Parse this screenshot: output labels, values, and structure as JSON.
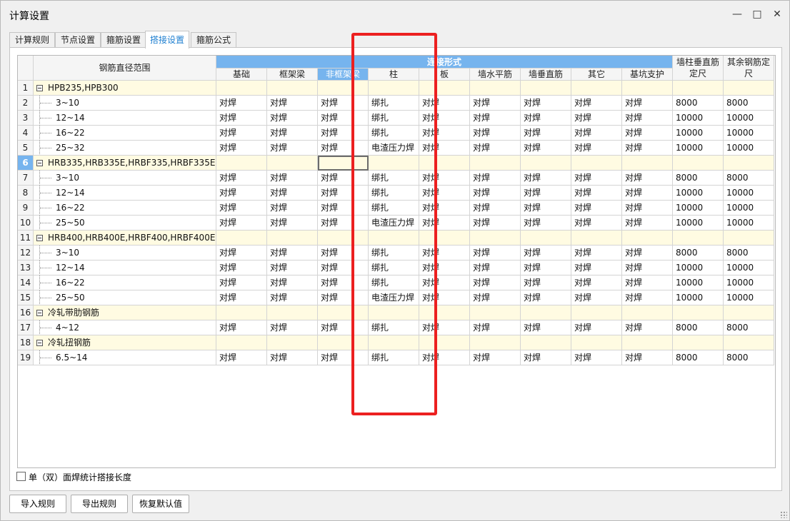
{
  "window": {
    "title": "计算设置"
  },
  "tabs": [
    {
      "label": "计算规则",
      "active": false
    },
    {
      "label": "节点设置",
      "active": false
    },
    {
      "label": "箍筋设置",
      "active": false
    },
    {
      "label": "搭接设置",
      "active": true
    },
    {
      "label": "箍筋公式",
      "active": false
    }
  ],
  "table": {
    "range_header": "钢筋直径范围",
    "group_header": "连接形式",
    "columns": [
      "基础",
      "框架梁",
      "非框架梁",
      "柱",
      "板",
      "墙水平筋",
      "墙垂直筋",
      "其它",
      "基坑支护"
    ],
    "extra_headers": [
      "墙柱垂直筋定尺",
      "其余钢筋定尺"
    ],
    "selected_column": 2,
    "selected_row": 6,
    "rows": [
      {
        "n": "1",
        "label": "HPB235,HPB300",
        "group": true
      },
      {
        "n": "2",
        "label": "3~10",
        "cells": [
          "对焊",
          "对焊",
          "对焊",
          "绑扎",
          "对焊",
          "对焊",
          "对焊",
          "对焊",
          "对焊",
          "8000",
          "8000"
        ]
      },
      {
        "n": "3",
        "label": "12~14",
        "cells": [
          "对焊",
          "对焊",
          "对焊",
          "绑扎",
          "对焊",
          "对焊",
          "对焊",
          "对焊",
          "对焊",
          "10000",
          "10000"
        ]
      },
      {
        "n": "4",
        "label": "16~22",
        "cells": [
          "对焊",
          "对焊",
          "对焊",
          "绑扎",
          "对焊",
          "对焊",
          "对焊",
          "对焊",
          "对焊",
          "10000",
          "10000"
        ]
      },
      {
        "n": "5",
        "label": "25~32",
        "cells": [
          "对焊",
          "对焊",
          "对焊",
          "电渣压力焊",
          "对焊",
          "对焊",
          "对焊",
          "对焊",
          "对焊",
          "10000",
          "10000"
        ]
      },
      {
        "n": "6",
        "label": "HRB335,HRB335E,HRBF335,HRBF335E",
        "group": true
      },
      {
        "n": "7",
        "label": "3~10",
        "cells": [
          "对焊",
          "对焊",
          "对焊",
          "绑扎",
          "对焊",
          "对焊",
          "对焊",
          "对焊",
          "对焊",
          "8000",
          "8000"
        ]
      },
      {
        "n": "8",
        "label": "12~14",
        "cells": [
          "对焊",
          "对焊",
          "对焊",
          "绑扎",
          "对焊",
          "对焊",
          "对焊",
          "对焊",
          "对焊",
          "10000",
          "10000"
        ]
      },
      {
        "n": "9",
        "label": "16~22",
        "cells": [
          "对焊",
          "对焊",
          "对焊",
          "绑扎",
          "对焊",
          "对焊",
          "对焊",
          "对焊",
          "对焊",
          "10000",
          "10000"
        ]
      },
      {
        "n": "10",
        "label": "25~50",
        "cells": [
          "对焊",
          "对焊",
          "对焊",
          "电渣压力焊",
          "对焊",
          "对焊",
          "对焊",
          "对焊",
          "对焊",
          "10000",
          "10000"
        ]
      },
      {
        "n": "11",
        "label": "HRB400,HRB400E,HRBF400,HRBF400E...",
        "group": true
      },
      {
        "n": "12",
        "label": "3~10",
        "cells": [
          "对焊",
          "对焊",
          "对焊",
          "绑扎",
          "对焊",
          "对焊",
          "对焊",
          "对焊",
          "对焊",
          "8000",
          "8000"
        ]
      },
      {
        "n": "13",
        "label": "12~14",
        "cells": [
          "对焊",
          "对焊",
          "对焊",
          "绑扎",
          "对焊",
          "对焊",
          "对焊",
          "对焊",
          "对焊",
          "10000",
          "10000"
        ]
      },
      {
        "n": "14",
        "label": "16~22",
        "cells": [
          "对焊",
          "对焊",
          "对焊",
          "绑扎",
          "对焊",
          "对焊",
          "对焊",
          "对焊",
          "对焊",
          "10000",
          "10000"
        ]
      },
      {
        "n": "15",
        "label": "25~50",
        "cells": [
          "对焊",
          "对焊",
          "对焊",
          "电渣压力焊",
          "对焊",
          "对焊",
          "对焊",
          "对焊",
          "对焊",
          "10000",
          "10000"
        ]
      },
      {
        "n": "16",
        "label": "冷轧带肋钢筋",
        "group": true
      },
      {
        "n": "17",
        "label": "4~12",
        "cells": [
          "对焊",
          "对焊",
          "对焊",
          "绑扎",
          "对焊",
          "对焊",
          "对焊",
          "对焊",
          "对焊",
          "8000",
          "8000"
        ]
      },
      {
        "n": "18",
        "label": "冷轧扭钢筋",
        "group": true
      },
      {
        "n": "19",
        "label": "6.5~14",
        "cells": [
          "对焊",
          "对焊",
          "对焊",
          "绑扎",
          "对焊",
          "对焊",
          "对焊",
          "对焊",
          "对焊",
          "8000",
          "8000"
        ]
      }
    ]
  },
  "checkbox": {
    "label": "单（双）面焊统计搭接长度",
    "checked": false
  },
  "buttons": {
    "import": "导入规则",
    "export": "导出规则",
    "restore": "恢复默认值"
  },
  "highlight": {
    "color": "#ec2020"
  }
}
